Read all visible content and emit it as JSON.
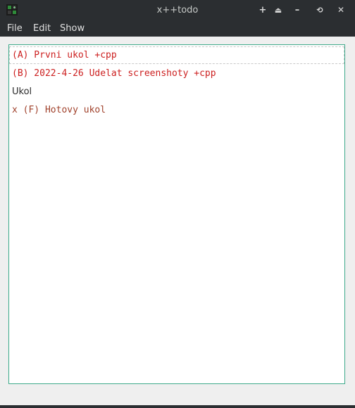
{
  "window": {
    "title": "x++todo"
  },
  "titlebar_buttons": [
    {
      "name": "maximize-plus-icon",
      "glyph": "+"
    },
    {
      "name": "shade-icon",
      "glyph": "⏏"
    },
    {
      "name": "minimize-icon",
      "glyph": "–"
    },
    {
      "name": "restore-icon",
      "glyph": "⟲"
    },
    {
      "name": "close-icon",
      "glyph": "✕"
    }
  ],
  "menu": {
    "file": "File",
    "edit": "Edit",
    "show": "Show"
  },
  "colors": {
    "priority_red": "#cc1f1f",
    "done_brown": "#a0412b",
    "plain_text": "#2b2b2b",
    "accent": "#3daa8a"
  },
  "tasks": [
    {
      "text": "(A) Prvni ukol +cpp",
      "color": "#cc1f1f"
    },
    {
      "text": "(B) 2022-4-26 Udelat screenshoty +cpp",
      "color": "#cc1f1f"
    },
    {
      "text": "Ukol",
      "color": "#2b2b2b"
    },
    {
      "text": "x (F) Hotovy ukol",
      "color": "#a0412b"
    }
  ]
}
